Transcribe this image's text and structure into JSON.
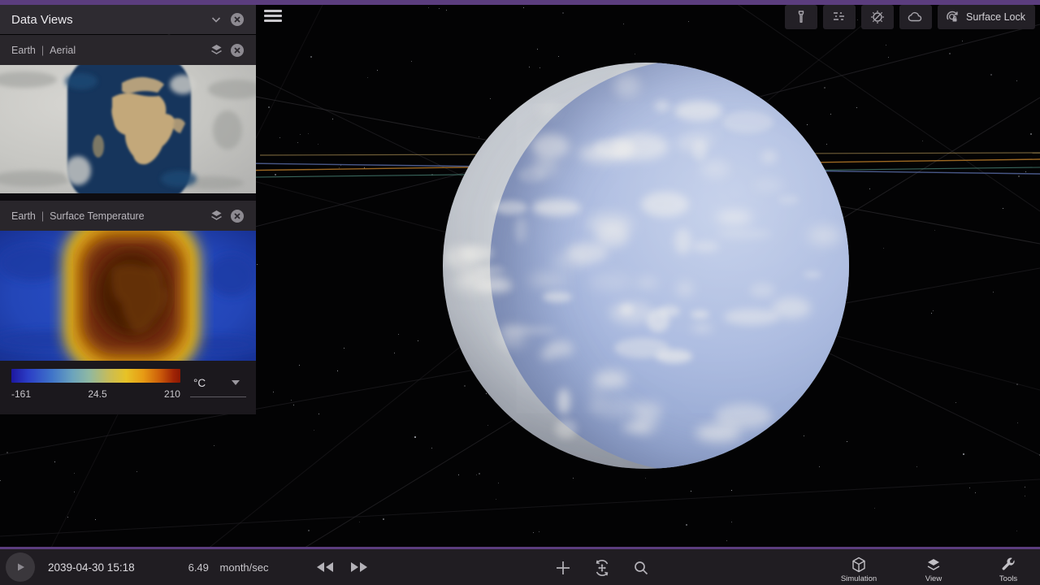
{
  "window": {
    "accent_color": "#5b3d7e",
    "bottom_bar_color": "#201d22"
  },
  "data_views_panel": {
    "title": "Data Views",
    "header_icons": [
      "chevron-down-icon",
      "close-icon"
    ],
    "views": [
      {
        "body": "Earth",
        "divider": "|",
        "layer": "Aerial",
        "icons": [
          "layers-icon",
          "close-icon"
        ]
      },
      {
        "body": "Earth",
        "divider": "|",
        "layer": "Surface Temperature",
        "icons": [
          "layers-icon",
          "close-icon"
        ]
      }
    ],
    "temperature_scale": {
      "min": "-161",
      "mid": "24.5",
      "max": "210",
      "unit": "°C",
      "gradient": [
        "#1d17a0",
        "#3f74c9",
        "#8fb8a2",
        "#e7c226",
        "#cc5c0a",
        "#8c1803"
      ]
    }
  },
  "top_toolbar": {
    "icons": [
      "flashlight-icon",
      "exposure-icon",
      "effects-icon",
      "clouds-icon"
    ],
    "surface_lock_label": "Surface Lock"
  },
  "bottom_bar": {
    "datetime": "2039-04-30 15:18",
    "speed_value": "6.49",
    "speed_unit": "month/sec",
    "transport_icons": [
      "play-icon",
      "rewind-icon",
      "fast-forward-icon"
    ],
    "center_icons": [
      "add-icon",
      "chase-icon",
      "search-icon"
    ],
    "menus": [
      {
        "label": "Simulation",
        "icon": "cube-icon"
      },
      {
        "label": "View",
        "icon": "layers-icon"
      },
      {
        "label": "Tools",
        "icon": "wrench-icon"
      }
    ]
  },
  "scene": {
    "orbit_colors": {
      "blue": "#5a6da8",
      "orange": "#b87a28",
      "teal": "#4f8f80",
      "tan": "#b89a5a"
    }
  }
}
